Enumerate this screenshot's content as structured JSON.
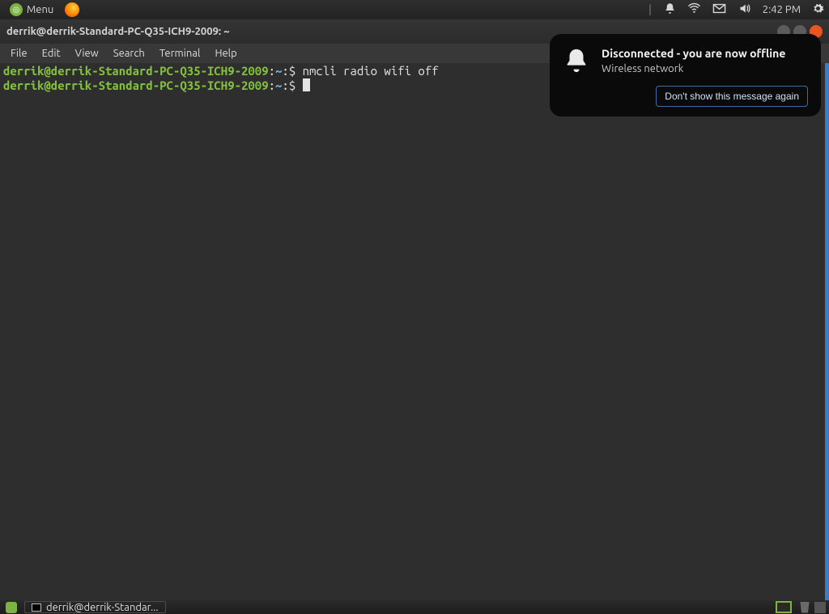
{
  "panel": {
    "menu_label": "Menu",
    "clock": "2:42 PM"
  },
  "terminal": {
    "title": "derrik@derrik-Standard-PC-Q35-ICH9-2009: ~",
    "menu": {
      "file": "File",
      "edit": "Edit",
      "view": "View",
      "search": "Search",
      "terminal": "Terminal",
      "help": "Help"
    },
    "lines": {
      "p1": "derrik@derrik-Standard-PC-Q35-ICH9-2009",
      "sep": ":",
      "path": "~",
      "dollar": "$",
      "cmd1": " nmcli radio wifi off"
    }
  },
  "notification": {
    "title": "Disconnected - you are now offline",
    "detail": "Wireless network",
    "button": "Don't show this message again"
  },
  "taskbar": {
    "task_title": "derrik@derrik-Standar..."
  }
}
